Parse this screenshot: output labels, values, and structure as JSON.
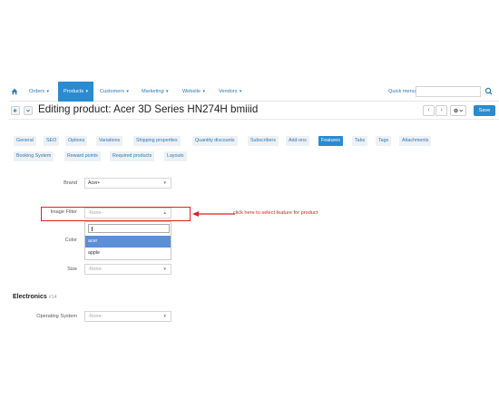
{
  "navbar": {
    "items": [
      {
        "label": "Orders"
      },
      {
        "label": "Products"
      },
      {
        "label": "Customers"
      },
      {
        "label": "Marketing"
      },
      {
        "label": "Website"
      },
      {
        "label": "Vendors"
      }
    ],
    "quick_menu": "Quick menu"
  },
  "titlebar": {
    "title": "Editing product: Acer 3D Series HN274H bmiiid",
    "save_label": "Save"
  },
  "tabs_row1": [
    "General",
    "SEO",
    "Options",
    "Variations",
    "Shipping properties",
    "Quantity discounts",
    "Subscribers",
    "Add-ons",
    "Features",
    "Tabs",
    "Tags",
    "Attachments"
  ],
  "tabs_row2": [
    "Booking System",
    "Reward points",
    "Required products",
    "Layouts"
  ],
  "active_tab": "Features",
  "features": {
    "brand": {
      "label": "Brand",
      "value": "Acer•"
    },
    "image_filter": {
      "label": "Image Filter",
      "value": "-None-"
    },
    "dropdown_options": [
      {
        "label": "acer",
        "selected": true
      },
      {
        "label": "apple",
        "selected": false
      }
    ],
    "color": {
      "label": "Color"
    },
    "size": {
      "label": "Size",
      "value": "-None-"
    }
  },
  "annotation": "click here to select feature for product",
  "electronics": {
    "title": "Electronics",
    "id": "#14",
    "os": {
      "label": "Operating System",
      "value": "-None-"
    }
  },
  "colors": {
    "accent": "#2a8bd1",
    "highlight": "#dd2222"
  }
}
